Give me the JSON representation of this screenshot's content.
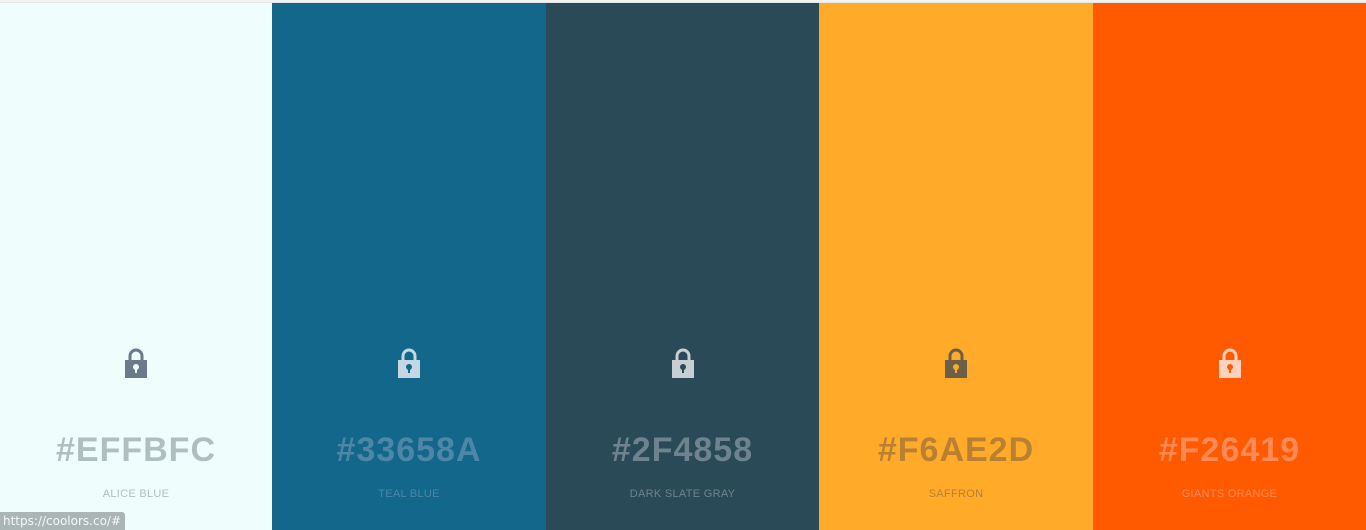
{
  "swatches": [
    {
      "hex": "#EFFBFC",
      "name": "ALICE BLUE",
      "bg": "#EFFEFD",
      "text_color": "#AFBEBF",
      "lock_color": "#6B7A88",
      "lock_hole": "#EFFEFD",
      "icon": "lock-icon"
    },
    {
      "hex": "#33658A",
      "name": "TEAL BLUE",
      "bg": "#13678A",
      "text_color": "#4D86A6",
      "lock_color": "#C4D7E3",
      "lock_hole": "#13678A",
      "icon": "lock-icon"
    },
    {
      "hex": "#2F4858",
      "name": "DARK SLATE GRAY",
      "bg": "#2A4A58",
      "text_color": "#6E838E",
      "lock_color": "#C7CFD4",
      "lock_hole": "#2A4A58",
      "icon": "lock-icon"
    },
    {
      "hex": "#F6AE2D",
      "name": "SAFFRON",
      "bg": "#FFAA28",
      "text_color": "#B88032",
      "lock_color": "#6A6048",
      "lock_hole": "#FFAA28",
      "icon": "lock-icon"
    },
    {
      "hex": "#F26419",
      "name": "GIANTS ORANGE",
      "bg": "#FF5A00",
      "text_color": "#FF8A55",
      "lock_color": "#FFD2BE",
      "lock_hole": "#FF5A00",
      "icon": "lock-icon"
    }
  ],
  "status_bar": {
    "url": "https://coolors.co/#"
  }
}
